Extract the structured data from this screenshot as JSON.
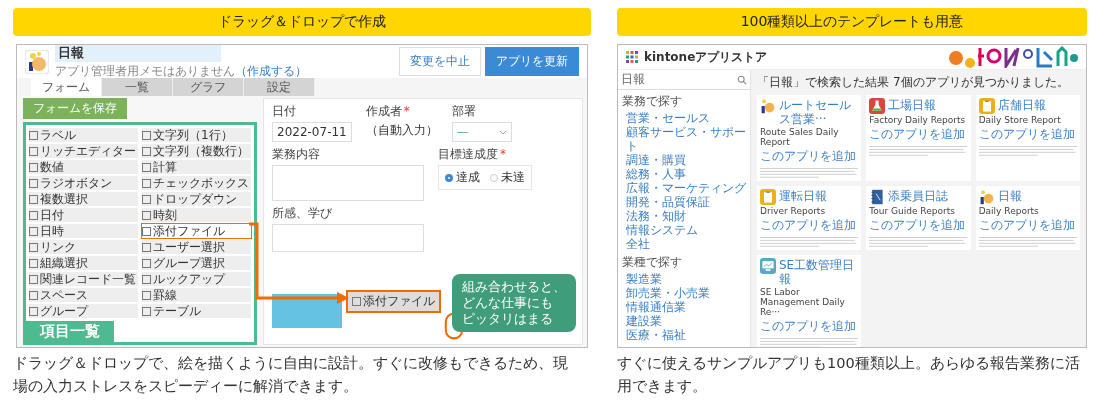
{
  "left": {
    "heading": "ドラッグ＆ドロップで作成",
    "app": {
      "title": "日報",
      "memo": "アプリ管理者用メモはありません",
      "memo_link": "（作成する）",
      "buttons": [
        {
          "label": "変更を中止",
          "kind": "secondary"
        },
        {
          "label": "アプリを更新",
          "kind": "primary"
        }
      ]
    },
    "tabs": [
      {
        "label": "フォーム",
        "selected": true
      },
      {
        "label": "一覧",
        "selected": false
      },
      {
        "label": "グラフ",
        "selected": false
      },
      {
        "label": "設定",
        "selected": false
      }
    ],
    "save_button": "フォームを保存",
    "palette": [
      {
        "label": "ラベル",
        "highlighted": false
      },
      {
        "label": "文字列（1行）",
        "highlighted": false
      },
      {
        "label": "リッチエディター",
        "highlighted": false
      },
      {
        "label": "文字列（複数行）",
        "highlighted": false
      },
      {
        "label": "数値",
        "highlighted": false
      },
      {
        "label": "計算",
        "highlighted": false
      },
      {
        "label": "ラジオボタン",
        "highlighted": false
      },
      {
        "label": "チェックボックス",
        "highlighted": false
      },
      {
        "label": "複数選択",
        "highlighted": false
      },
      {
        "label": "ドロップダウン",
        "highlighted": false
      },
      {
        "label": "日付",
        "highlighted": false
      },
      {
        "label": "時刻",
        "highlighted": false
      },
      {
        "label": "日時",
        "highlighted": false
      },
      {
        "label": "添付ファイル",
        "highlighted": true
      },
      {
        "label": "リンク",
        "highlighted": false
      },
      {
        "label": "ユーザー選択",
        "highlighted": false
      },
      {
        "label": "組織選択",
        "highlighted": false
      },
      {
        "label": "グループ選択",
        "highlighted": false
      },
      {
        "label": "関連レコード一覧",
        "highlighted": false
      },
      {
        "label": "ルックアップ",
        "highlighted": false
      },
      {
        "label": "スペース",
        "highlighted": false
      },
      {
        "label": "罫線",
        "highlighted": false
      },
      {
        "label": "グループ",
        "highlighted": false
      },
      {
        "label": "テーブル",
        "highlighted": false
      }
    ],
    "palette_title": "項目一覧",
    "form": {
      "date_label": "日付",
      "date_value": "2022-07-11",
      "author_label": "作成者",
      "author_mark": "*",
      "author_value": "（自動入力）",
      "dept_label": "部署",
      "dept_value": "—",
      "work_label": "業務内容",
      "goal_label": "目標達成度",
      "goal_mark": "*",
      "goal_options": [
        {
          "label": "達成",
          "selected": true
        },
        {
          "label": "未達",
          "selected": false
        }
      ],
      "notes_label": "所感、学び"
    },
    "dragged_item": "添付ファイル",
    "callout_lines": [
      "組み合わせると、",
      "どんな仕事にも",
      "ピッタリはまる"
    ],
    "caption": "ドラッグ＆ドロップで、絵を描くように自由に設計。すぐに改修もできるため、現場の入力ストレスをスピーディーに解消できます。"
  },
  "right": {
    "heading": "100種類以上のテンプレートも用意",
    "store": {
      "title": "kintoneアプリストア",
      "search_value": "日報",
      "sidebar": [
        {
          "heading": "業務で探す",
          "items": [
            "営業・セールス",
            "顧客サービス・サポート",
            "調達・購買",
            "総務・人事",
            "広報・マーケティング",
            "開発・品質保証",
            "法務・知財",
            "情報システム",
            "全社"
          ]
        },
        {
          "heading": "業種で探す",
          "items": [
            "製造業",
            "卸売業・小売業",
            "情報通信業",
            "建設業",
            "医療・福祉"
          ]
        }
      ],
      "results_title": "「日報」で検索した結果",
      "results_count": "7個のアプリが見つかりました。",
      "cards": [
        {
          "title": "ルートセールス営業···",
          "subtitle": "Route Sales Daily Report",
          "link": "このアプリを追加",
          "kind": "hand",
          "color": "#f2b24c"
        },
        {
          "title": "工場日報",
          "subtitle": "Factory Daily Reports",
          "link": "このアプリを追加",
          "kind": "flask",
          "color": "#d9463b"
        },
        {
          "title": "店舗日報",
          "subtitle": "Daily Store Report",
          "link": "このアプリを追加",
          "kind": "clipboard",
          "color": "#e8b21c"
        },
        {
          "title": "運転日報",
          "subtitle": "Driver Reports",
          "link": "このアプリを追加",
          "kind": "clipboard",
          "color": "#e8b21c"
        },
        {
          "title": "添乗員日誌",
          "subtitle": "Tour Guide Reports",
          "link": "このアプリを追加",
          "kind": "notebook",
          "color": "#2f5f9e"
        },
        {
          "title": "日報",
          "subtitle": "Daily Reports",
          "link": "このアプリを追加",
          "kind": "hand",
          "color": "#f2b24c"
        },
        {
          "title": "SE工数管理日報",
          "subtitle": "SE Labor Management Daily Re···",
          "link": "このアプリを追加",
          "kind": "monitor",
          "color": "#5aa7c4"
        }
      ]
    },
    "caption": "すぐに使えるサンプルアプリも100種類以上。あらゆる報告業務に活用できます。"
  }
}
